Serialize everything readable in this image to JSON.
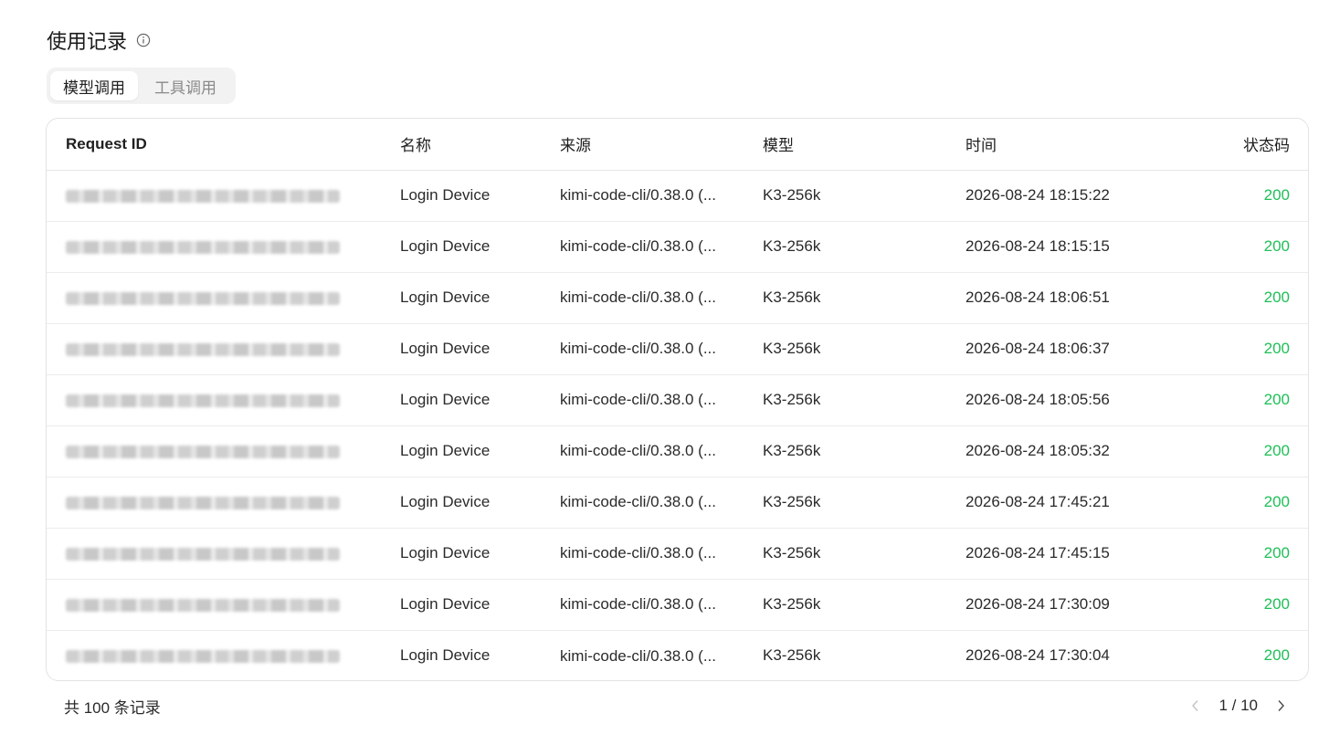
{
  "header": {
    "title": "使用记录",
    "info_icon": "info-circle-icon"
  },
  "tabs": [
    {
      "label": "模型调用",
      "active": true
    },
    {
      "label": "工具调用",
      "active": false
    }
  ],
  "table": {
    "columns": [
      "Request ID",
      "名称",
      "来源",
      "模型",
      "时间",
      "状态码"
    ],
    "rows": [
      {
        "name": "Login Device",
        "source": "kimi-code-cli/0.38.0 (...",
        "model": "K3-256k",
        "time": "2026-08-24 18:15:22",
        "status": "200"
      },
      {
        "name": "Login Device",
        "source": "kimi-code-cli/0.38.0 (...",
        "model": "K3-256k",
        "time": "2026-08-24 18:15:15",
        "status": "200"
      },
      {
        "name": "Login Device",
        "source": "kimi-code-cli/0.38.0 (...",
        "model": "K3-256k",
        "time": "2026-08-24 18:06:51",
        "status": "200"
      },
      {
        "name": "Login Device",
        "source": "kimi-code-cli/0.38.0 (...",
        "model": "K3-256k",
        "time": "2026-08-24 18:06:37",
        "status": "200"
      },
      {
        "name": "Login Device",
        "source": "kimi-code-cli/0.38.0 (...",
        "model": "K3-256k",
        "time": "2026-08-24 18:05:56",
        "status": "200"
      },
      {
        "name": "Login Device",
        "source": "kimi-code-cli/0.38.0 (...",
        "model": "K3-256k",
        "time": "2026-08-24 18:05:32",
        "status": "200"
      },
      {
        "name": "Login Device",
        "source": "kimi-code-cli/0.38.0 (...",
        "model": "K3-256k",
        "time": "2026-08-24 17:45:21",
        "status": "200"
      },
      {
        "name": "Login Device",
        "source": "kimi-code-cli/0.38.0 (...",
        "model": "K3-256k",
        "time": "2026-08-24 17:45:15",
        "status": "200"
      },
      {
        "name": "Login Device",
        "source": "kimi-code-cli/0.38.0 (...",
        "model": "K3-256k",
        "time": "2026-08-24 17:30:09",
        "status": "200"
      },
      {
        "name": "Login Device",
        "source": "kimi-code-cli/0.38.0 (...",
        "model": "K3-256k",
        "time": "2026-08-24 17:30:04",
        "status": "200"
      }
    ]
  },
  "footer": {
    "total_text": "共 100 条记录",
    "page_indicator": "1 / 10",
    "prev_icon": "chevron-left-icon",
    "next_icon": "chevron-right-icon"
  },
  "colors": {
    "status_ok": "#1fbf57",
    "tab_bg": "#f2f2f2",
    "border": "#e3e3e3"
  }
}
